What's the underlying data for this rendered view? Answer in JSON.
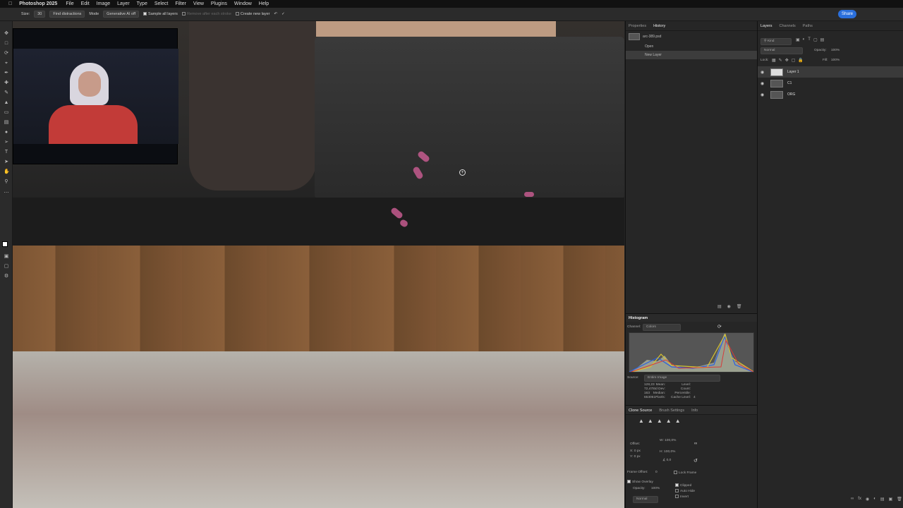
{
  "menubar": {
    "app": "Photoshop 2025",
    "items": [
      "File",
      "Edit",
      "Image",
      "Layer",
      "Type",
      "Select",
      "Filter",
      "View",
      "Plugins",
      "Window",
      "Help"
    ]
  },
  "options": {
    "size_label": "Size:",
    "size_value": "30",
    "find_distractions": "Find distractions",
    "mode_label": "Mode",
    "mode_value": "Generative AI off",
    "sample_all_layers": "Sample all layers",
    "remove_after_stroke": "Remove after each stroke",
    "create_new_layer": "Create new layer",
    "share": "Share"
  },
  "history_panel": {
    "tabs": [
      "Properties",
      "History"
    ],
    "doc": "arc-389.psd",
    "items": [
      "Open",
      "New Layer"
    ]
  },
  "layers_panel": {
    "tabs": [
      "Layers",
      "Channels",
      "Paths"
    ],
    "kind": "Kind",
    "blend": "Normal",
    "opacity_label": "Opacity:",
    "opacity": "100%",
    "lock_label": "Lock:",
    "fill_label": "Fill:",
    "fill": "100%",
    "layers": [
      "Layer 1",
      "C1",
      "ORG"
    ]
  },
  "histogram": {
    "title": "Histogram",
    "channel_label": "Channel:",
    "channel": "Colors",
    "source_label": "Source:",
    "source": "Entire Image",
    "mean_label": "Mean:",
    "mean": "128,23",
    "stddev_label": "Std Dev:",
    "stddev": "72,47",
    "median_label": "Median:",
    "median": "163",
    "pixels_label": "Pixels:",
    "pixels": "653051",
    "level_label": "Level:",
    "count_label": "Count:",
    "percentile_label": "Percentile:",
    "cache_label": "Cache Level:",
    "cache": "4"
  },
  "clone_source": {
    "tabs": [
      "Clone Source",
      "Brush Settings",
      "Info"
    ],
    "offset_label": "Offset:",
    "w": "100,0%",
    "h": "100,0%",
    "x": "0 px",
    "y": "0 px",
    "angle": "0,0",
    "frame_offset_label": "Frame Offset:",
    "frame_offset": "0",
    "lock_frame": "Lock Frame",
    "show_overlay": "Show Overlay",
    "opacity_label": "Opacity:",
    "opacity": "100%",
    "clipped": "Clipped",
    "auto_hide": "Auto Hide",
    "invert": "Invert",
    "blend": "Normal"
  }
}
